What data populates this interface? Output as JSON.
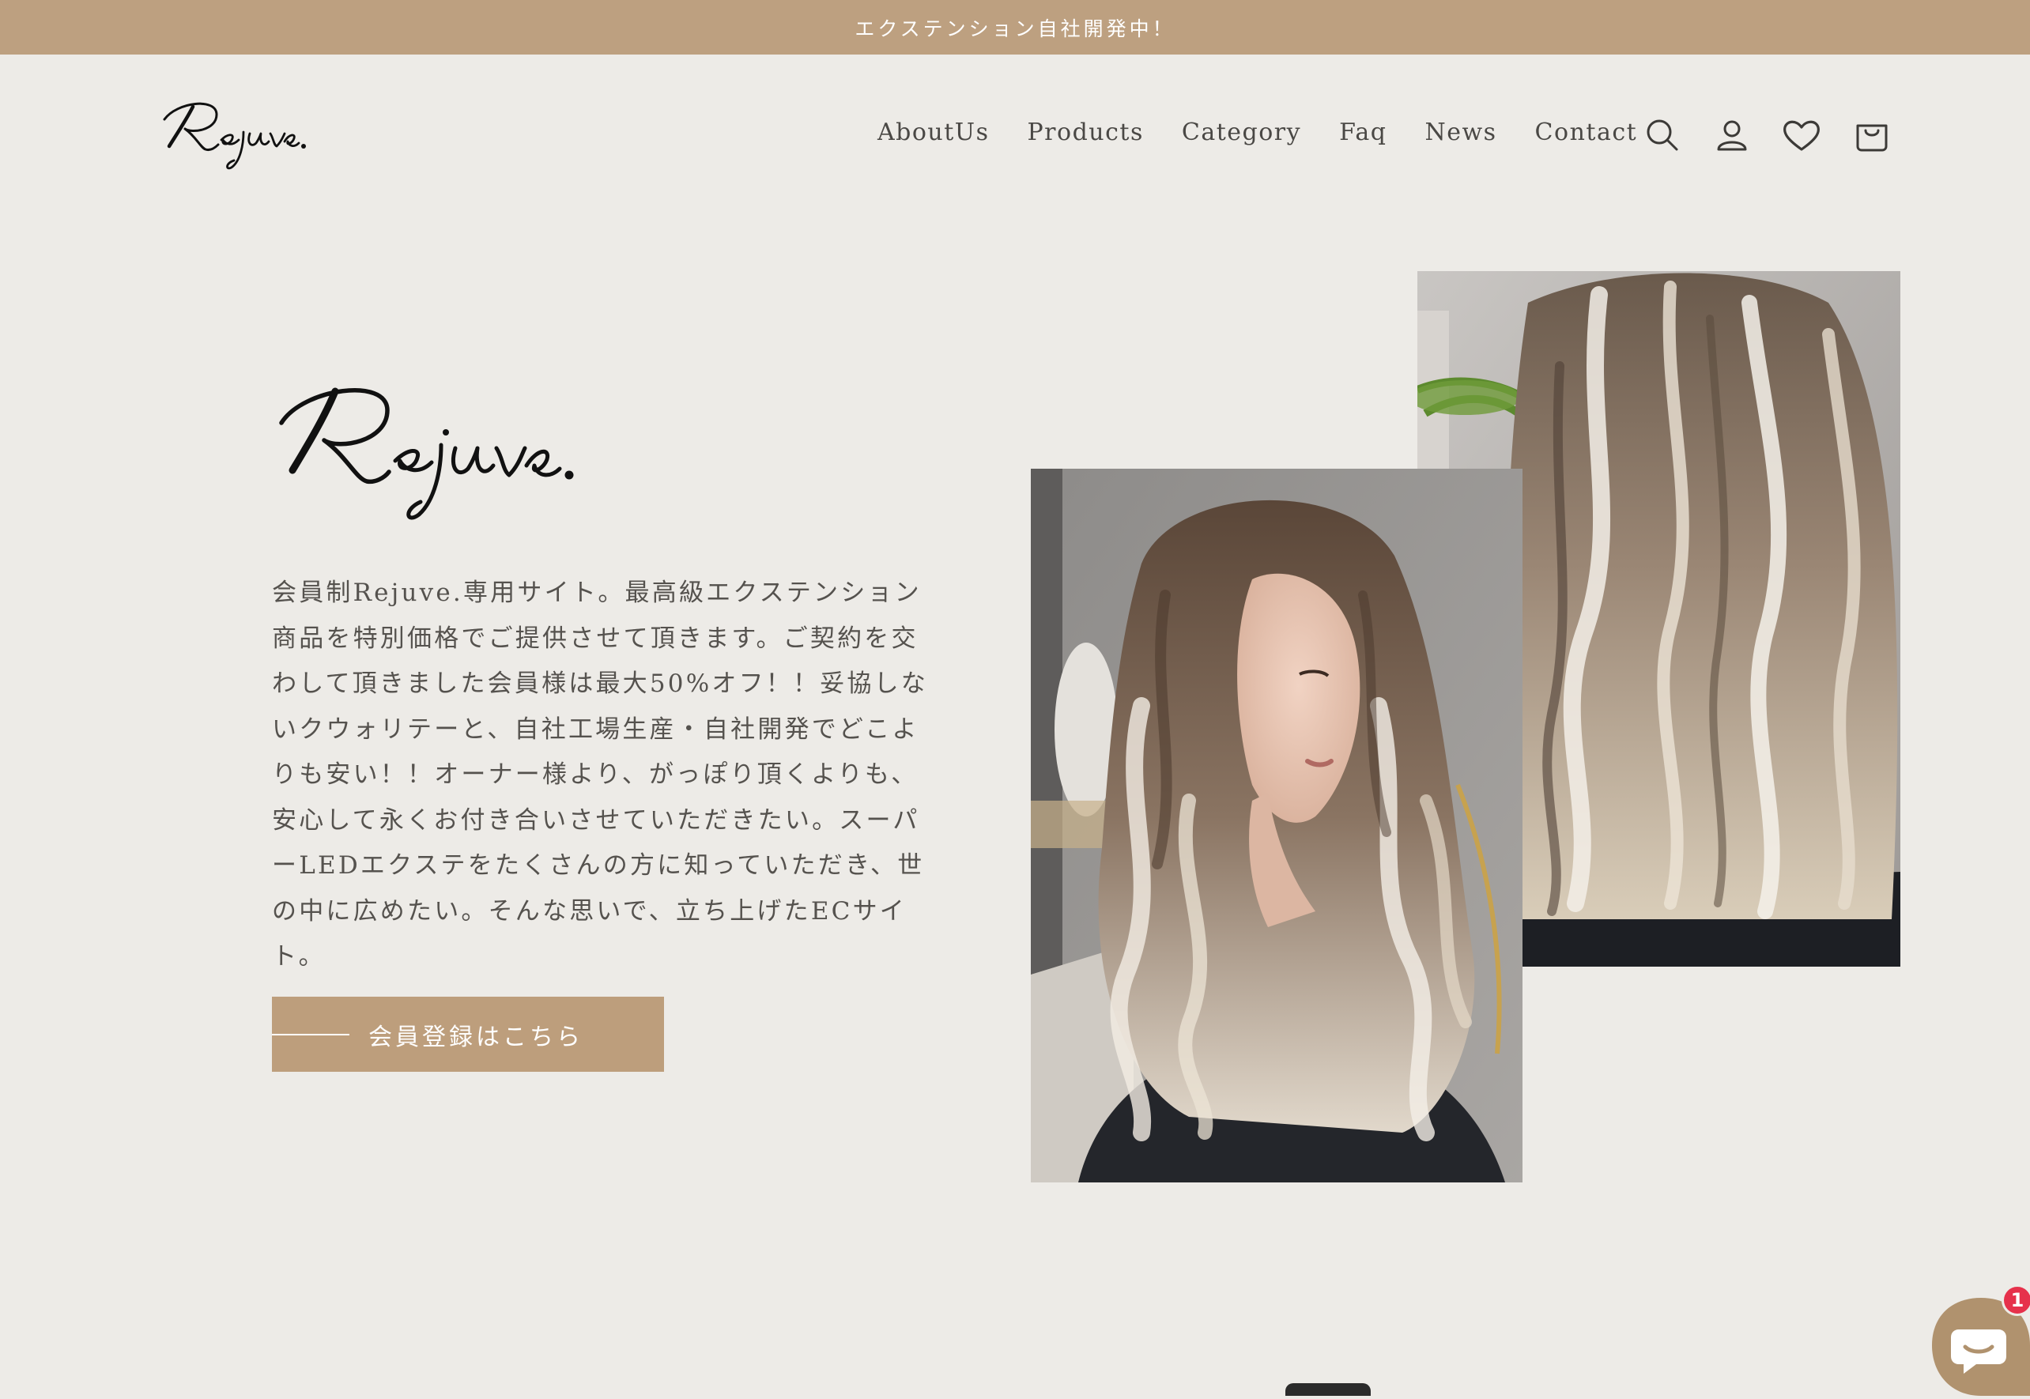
{
  "announcement": {
    "text": "エクステンション自社開発中！"
  },
  "header": {
    "logo_text": "Rejuve.",
    "nav": [
      {
        "label": "AboutUs"
      },
      {
        "label": "Products"
      },
      {
        "label": "Category"
      },
      {
        "label": "Faq"
      },
      {
        "label": "News"
      },
      {
        "label": "Contact"
      }
    ],
    "icons": [
      "search-icon",
      "account-icon",
      "heart-icon",
      "cart-icon"
    ]
  },
  "hero": {
    "logo_text": "Rejuve.",
    "description": "会員制Rejuve.専用サイト。最高級エクステンション商品を特別価格でご提供させて頂きます。ご契約を交わして頂きました会員様は最大50%オフ！！妥協しないクウォリテーと、自社工場生産・自社開発でどこよりも安い！！オーナー様より、がっぽり頂くよりも、安心して永くお付き合いさせていただきたい。スーパーLEDエクステをたくさんの方に知っていただき、世の中に広めたい。そんな思いで、立ち上げたECサイト。",
    "cta_label": "会員登録はこちら"
  },
  "chat": {
    "badge_count": "1",
    "icon": "chat-bubble-icon"
  },
  "colors": {
    "accent": "#bd9e7c",
    "background": "#edebe7",
    "text": "#3c3a37",
    "badge": "#e6314b"
  }
}
